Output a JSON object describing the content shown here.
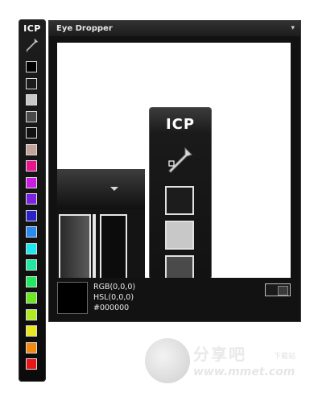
{
  "sidebar": {
    "logo": "ICP",
    "dropper_icon": "eyedropper-icon",
    "swatches": [
      "#000000",
      "#1c1c1c",
      "#c8c8c8",
      "#4a4a4a",
      "#111111",
      "#c4a49a",
      "#e8158c",
      "#c81ee0",
      "#7a22e0",
      "#2a24c8",
      "#2a8af0",
      "#1de8f0",
      "#22e8a0",
      "#22e860",
      "#6ae822",
      "#b0e822",
      "#e8e822",
      "#f08a10",
      "#e81818"
    ]
  },
  "panel": {
    "title": "Eye Dropper",
    "menu_icon": "▾",
    "magnified_logo": "ICP",
    "color_info": {
      "swatch": "#000000",
      "rgb": "RGB(0,0,0)",
      "hsl": "HSL(0,0,0)",
      "hex": "#000000"
    }
  },
  "watermark": {
    "text": "分享吧",
    "small": "下载站",
    "url": "www.mmet.com"
  }
}
